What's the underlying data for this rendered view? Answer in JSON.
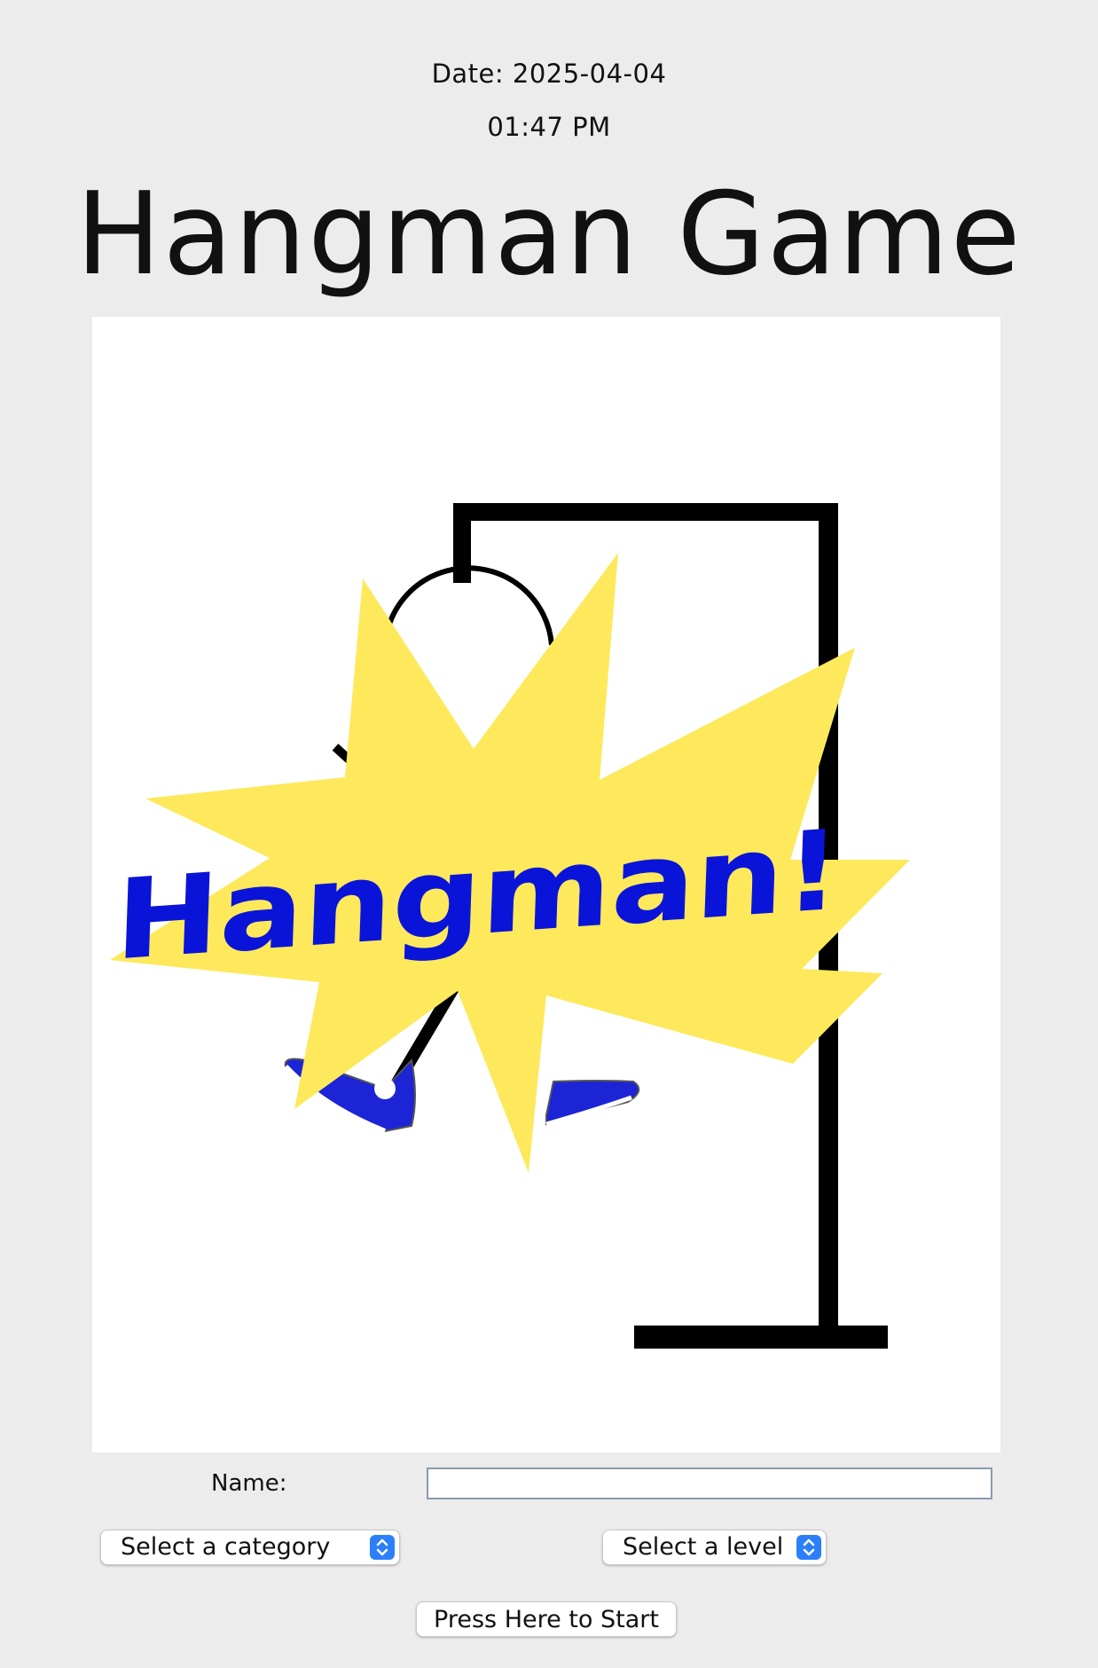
{
  "header": {
    "date": "Date: 2025-04-04",
    "time": "01:47 PM",
    "title": "Hangman Game"
  },
  "illustration": {
    "splash_text": "Hangman!",
    "colors": {
      "starburst": "#fde95b",
      "splash_text": "#0a14d8",
      "gallows": "#000000",
      "shoes": "#1c24d6"
    }
  },
  "form": {
    "name_label": "Name:",
    "name_value": "",
    "category_select": "Select a category",
    "level_select": "Select a level",
    "start_button": "Press Here to Start"
  },
  "colors": {
    "background": "#ececec",
    "canvas": "#ffffff",
    "select_accent": "#2d7ff9"
  }
}
